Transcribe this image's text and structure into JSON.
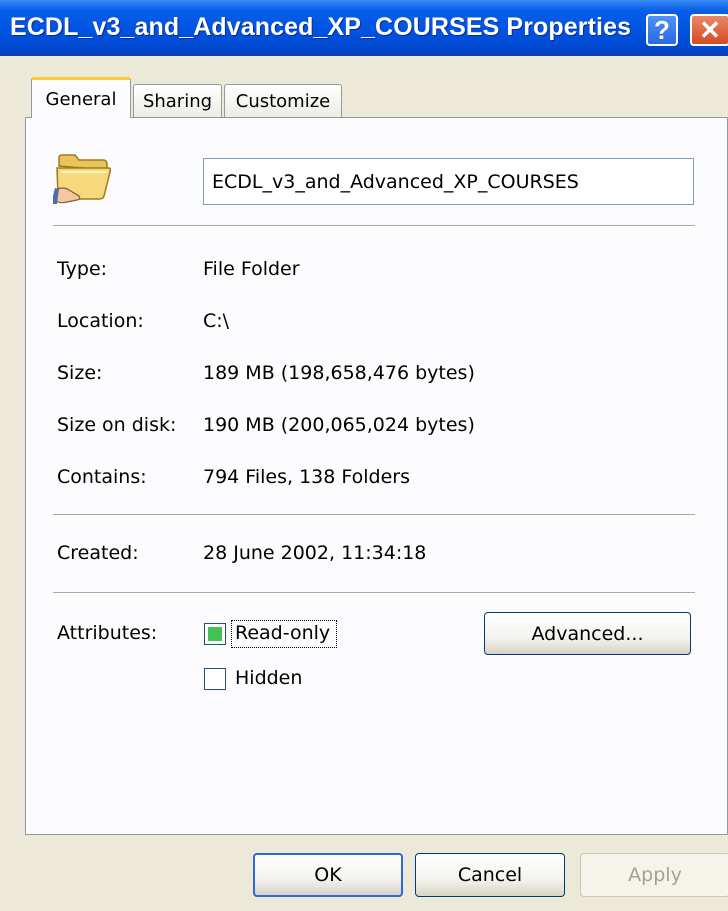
{
  "window": {
    "title": "ECDL_v3_and_Advanced_XP_COURSES Properties",
    "help_glyph": "?",
    "close_glyph": "✕"
  },
  "tabs": [
    {
      "label": "General",
      "selected": true
    },
    {
      "label": "Sharing",
      "selected": false
    },
    {
      "label": "Customize",
      "selected": false
    }
  ],
  "general": {
    "icon": "folder-icon",
    "folder_name": "ECDL_v3_and_Advanced_XP_COURSES",
    "properties": [
      {
        "label": "Type:",
        "value": "File Folder"
      },
      {
        "label": "Location:",
        "value": "C:\\"
      },
      {
        "label": "Size:",
        "value": "189 MB (198,658,476 bytes)"
      },
      {
        "label": "Size on disk:",
        "value": "190 MB (200,065,024 bytes)"
      },
      {
        "label": "Contains:",
        "value": "794 Files, 138 Folders"
      }
    ],
    "created": {
      "label": "Created:",
      "value": "28 June 2002, 11:34:18"
    },
    "attributes": {
      "label": "Attributes:",
      "read_only": {
        "label": "Read-only",
        "state": "mixed"
      },
      "hidden": {
        "label": "Hidden",
        "checked": false
      },
      "advanced_label": "Advanced..."
    }
  },
  "buttons": {
    "ok": "OK",
    "cancel": "Cancel",
    "apply": "Apply",
    "apply_enabled": false
  },
  "colors": {
    "titlebar": "#0054e3",
    "dialog_bg": "#ece9d8",
    "panel_bg": "#fcfcfe",
    "tab_highlight": "#ffc83c",
    "checkbox_mixed_fill": "#42c253"
  }
}
